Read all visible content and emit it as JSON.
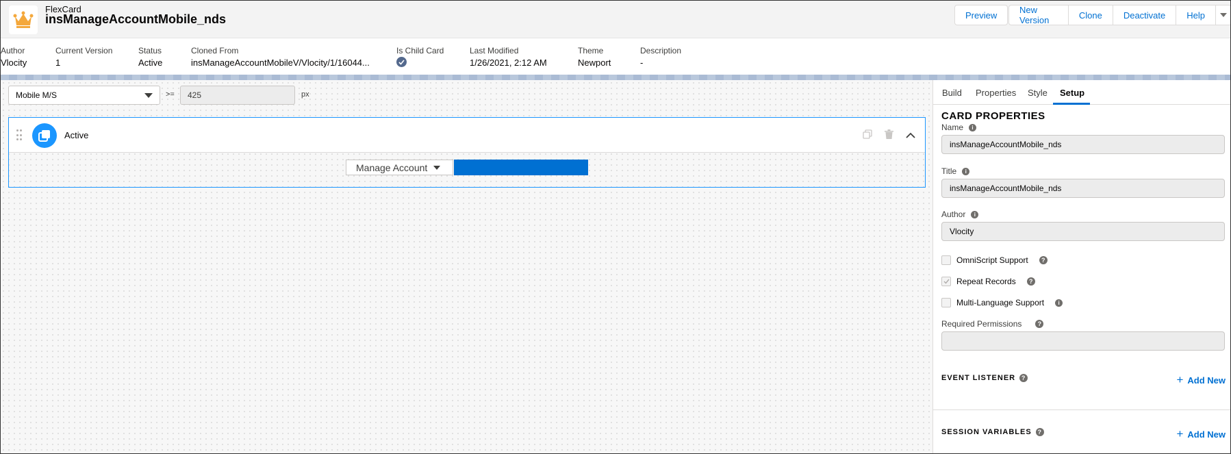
{
  "header": {
    "app_type": "FlexCard",
    "title": "insManageAccountMobile_nds",
    "buttons": {
      "preview": "Preview",
      "new_version": "New Version",
      "clone": "Clone",
      "deactivate": "Deactivate",
      "help": "Help"
    }
  },
  "meta": [
    {
      "label": "Author",
      "value": "Vlocity"
    },
    {
      "label": "Current Version",
      "value": "1"
    },
    {
      "label": "Status",
      "value": "Active"
    },
    {
      "label": "Cloned From",
      "value": "insManageAccountMobileV/Vlocity/1/16044..."
    },
    {
      "label": "Is Child Card",
      "value": ""
    },
    {
      "label": "Last Modified",
      "value": "1/26/2021, 2:12 AM"
    },
    {
      "label": "Theme",
      "value": "Newport"
    },
    {
      "label": "Description",
      "value": "-"
    }
  ],
  "canvas": {
    "device": "Mobile M/S",
    "operator": ">=",
    "width_value": "425",
    "unit": "px",
    "state": {
      "name": "Active",
      "menu_label": "Manage Account"
    }
  },
  "panel": {
    "tabs": [
      "Build",
      "Properties",
      "Style",
      "Setup"
    ],
    "active_tab": "Setup",
    "section_title": "CARD PROPERTIES",
    "fields": {
      "name_label": "Name",
      "name_value": "insManageAccountMobile_nds",
      "title_label": "Title",
      "title_value": "insManageAccountMobile_nds",
      "author_label": "Author",
      "author_value": "Vlocity"
    },
    "checkboxes": [
      {
        "label": "OmniScript Support",
        "checked": false
      },
      {
        "label": "Repeat Records",
        "checked": true
      },
      {
        "label": "Multi-Language Support",
        "checked": false
      }
    ],
    "required_permissions_label": "Required Permissions",
    "required_permissions_value": "",
    "event_listener_title": "EVENT LISTENER",
    "session_variables_title": "SESSION VARIABLES",
    "add_new_label": "Add New"
  },
  "colors": {
    "brand_blue": "#0070d2",
    "state_icon": "#1b96ff",
    "crown": "#f4a83c"
  }
}
